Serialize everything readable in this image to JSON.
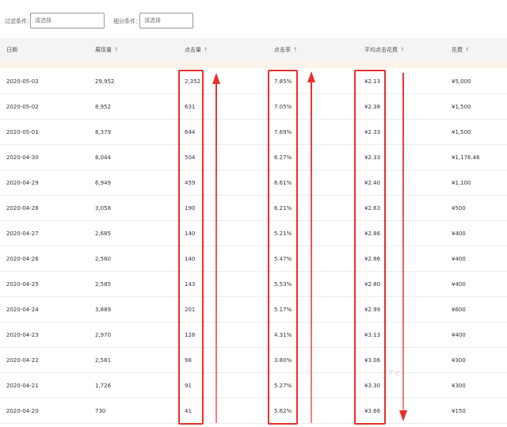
{
  "filters": {
    "filter_label": "过滤条件：",
    "filter_placeholder": "请选择",
    "segment_label": "细分条件：",
    "segment_placeholder": "请选择"
  },
  "table": {
    "columns": [
      {
        "label": "日期",
        "sortable": false
      },
      {
        "label": "展现量",
        "sortable": true
      },
      {
        "label": "点击量",
        "sortable": true
      },
      {
        "label": "点击率",
        "sortable": true
      },
      {
        "label": "平均点击花费",
        "sortable": true
      },
      {
        "label": "花费",
        "sortable": true
      }
    ],
    "sort_icon": "↑",
    "rows": [
      {
        "date": "2020-05-03",
        "impressions": "29,952",
        "clicks": "2,352",
        "ctr": "7.85%",
        "cpc": "¥2.13",
        "cost": "¥5,000"
      },
      {
        "date": "2020-05-02",
        "impressions": "8,952",
        "clicks": "631",
        "ctr": "7.05%",
        "cpc": "¥2.38",
        "cost": "¥1,500"
      },
      {
        "date": "2020-05-01",
        "impressions": "8,379",
        "clicks": "644",
        "ctr": "7.69%",
        "cpc": "¥2.33",
        "cost": "¥1,500"
      },
      {
        "date": "2020-04-30",
        "impressions": "8,044",
        "clicks": "504",
        "ctr": "6.27%",
        "cpc": "¥2.33",
        "cost": "¥1,176.46"
      },
      {
        "date": "2020-04-29",
        "impressions": "6,949",
        "clicks": "459",
        "ctr": "6.61%",
        "cpc": "¥2.40",
        "cost": "¥1,100"
      },
      {
        "date": "2020-04-28",
        "impressions": "3,058",
        "clicks": "190",
        "ctr": "6.21%",
        "cpc": "¥2.63",
        "cost": "¥500"
      },
      {
        "date": "2020-04-27",
        "impressions": "2,685",
        "clicks": "140",
        "ctr": "5.21%",
        "cpc": "¥2.86",
        "cost": "¥400"
      },
      {
        "date": "2020-04-26",
        "impressions": "2,560",
        "clicks": "140",
        "ctr": "5.47%",
        "cpc": "¥2.86",
        "cost": "¥400"
      },
      {
        "date": "2020-04-25",
        "impressions": "2,585",
        "clicks": "143",
        "ctr": "5.53%",
        "cpc": "¥2.80",
        "cost": "¥400"
      },
      {
        "date": "2020-04-24",
        "impressions": "3,889",
        "clicks": "201",
        "ctr": "5.17%",
        "cpc": "¥2.99",
        "cost": "¥600"
      },
      {
        "date": "2020-04-23",
        "impressions": "2,970",
        "clicks": "128",
        "ctr": "4.31%",
        "cpc": "¥3.13",
        "cost": "¥400"
      },
      {
        "date": "2020-04-22",
        "impressions": "2,581",
        "clicks": "98",
        "ctr": "3.80%",
        "cpc": "¥3.06",
        "cost": "¥300"
      },
      {
        "date": "2020-04-21",
        "impressions": "1,726",
        "clicks": "91",
        "ctr": "5.27%",
        "cpc": "¥3.30",
        "cost": "¥300"
      },
      {
        "date": "2020-04-20",
        "impressions": "730",
        "clicks": "41",
        "ctr": "5.62%",
        "cpc": "¥3.66",
        "cost": "¥150"
      }
    ]
  },
  "annotations": {
    "highlight_color": "#e8302a",
    "arrows": [
      {
        "column": "clicks",
        "direction": "up"
      },
      {
        "column": "ctr",
        "direction": "up"
      },
      {
        "column": "cpc",
        "direction": "down"
      }
    ]
  }
}
